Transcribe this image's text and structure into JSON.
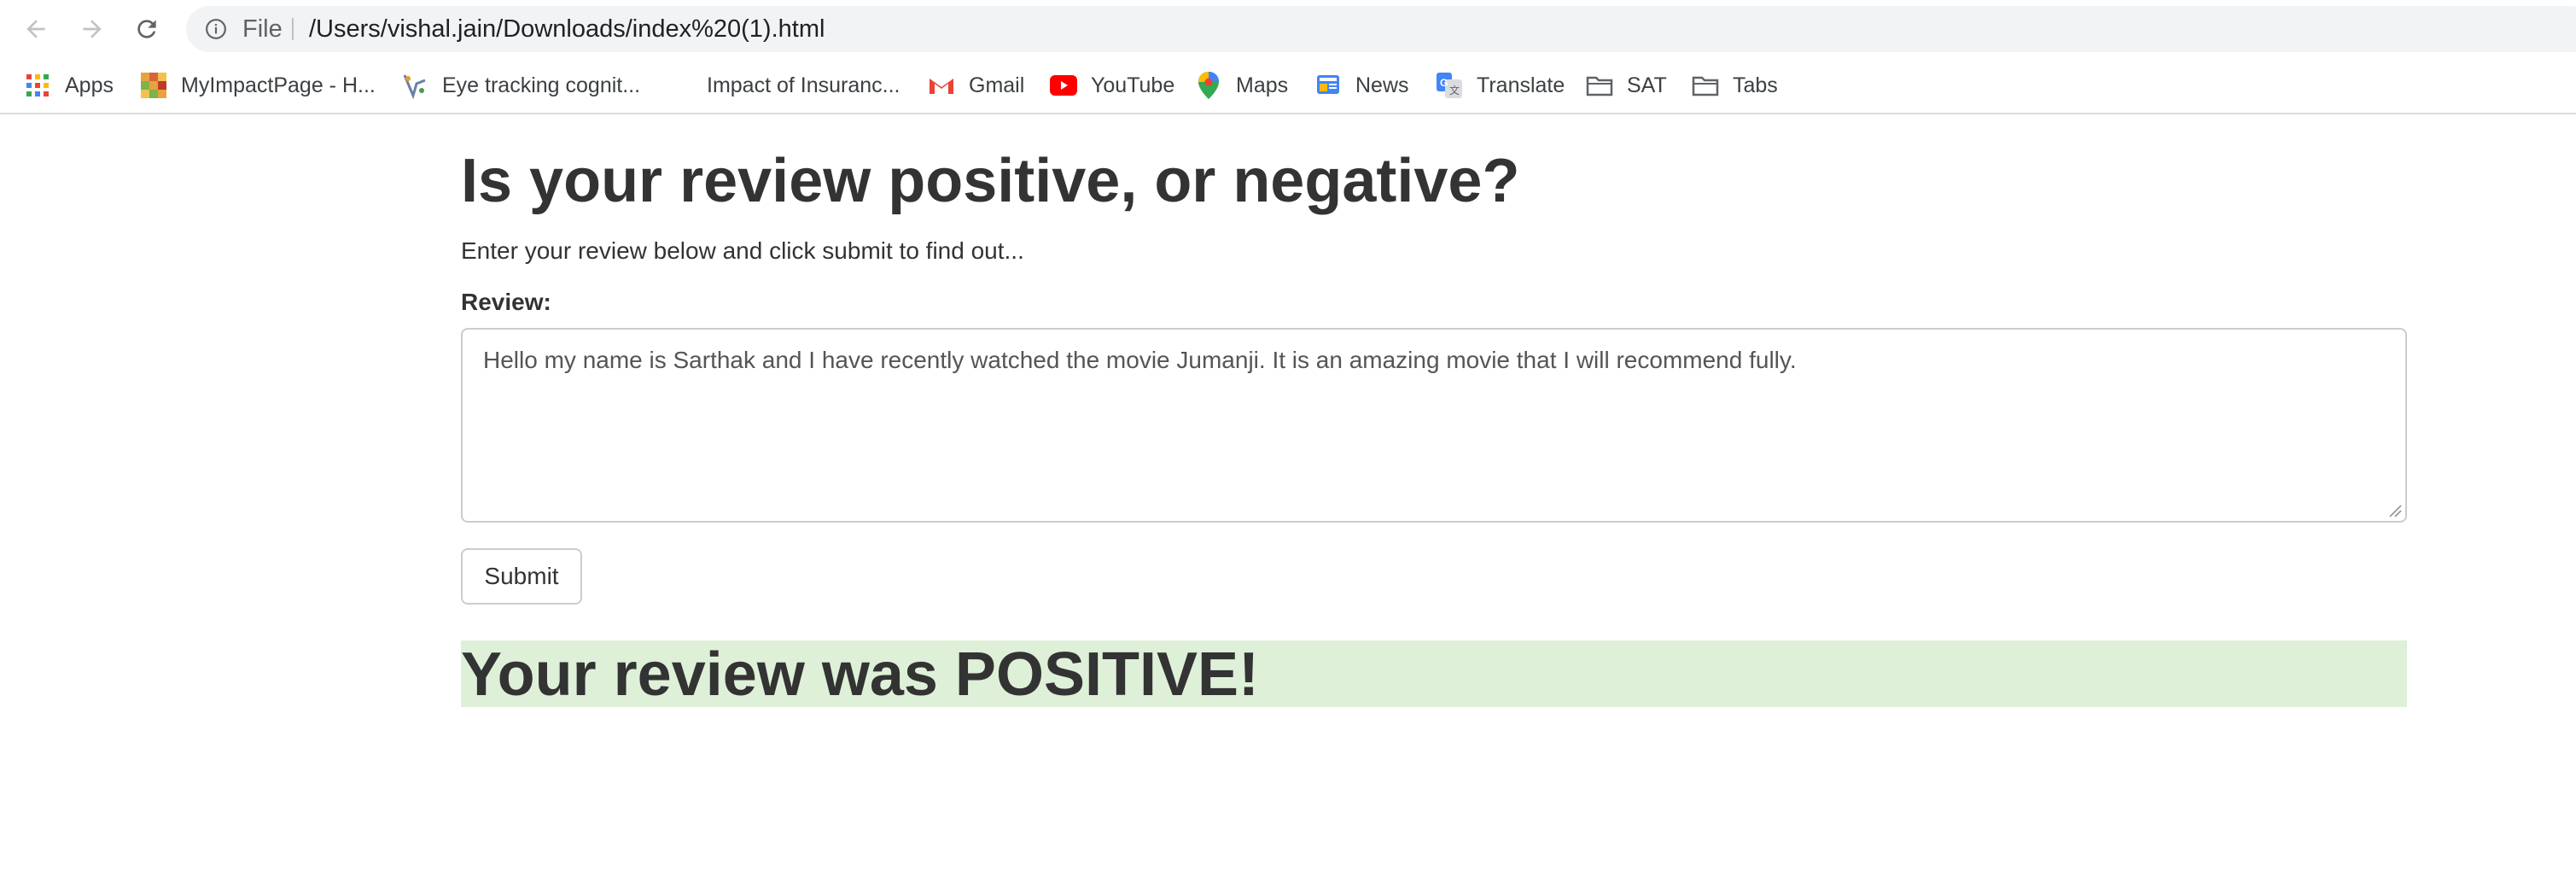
{
  "browser": {
    "scheme_label": "File",
    "url": "/Users/vishal.jain/Downloads/index%20(1).html",
    "nav_icons": [
      "back-arrow-icon",
      "forward-arrow-icon",
      "reload-icon",
      "info-icon"
    ]
  },
  "bookmarks": [
    {
      "label": "Apps",
      "icon": "apps-grid-icon"
    },
    {
      "label": "MyImpactPage - H...",
      "icon": "myimpactpage-icon"
    },
    {
      "label": "Eye tracking cognit...",
      "icon": "eye-tracking-icon"
    },
    {
      "label": "Impact of Insuranc...",
      "icon": ""
    },
    {
      "label": "Gmail",
      "icon": "gmail-icon"
    },
    {
      "label": "YouTube",
      "icon": "youtube-icon"
    },
    {
      "label": "Maps",
      "icon": "maps-pin-icon"
    },
    {
      "label": "News",
      "icon": "news-icon"
    },
    {
      "label": "Translate",
      "icon": "translate-icon"
    },
    {
      "label": "SAT",
      "icon": "folder-icon"
    },
    {
      "label": "Tabs",
      "icon": "folder-icon"
    }
  ],
  "page": {
    "title": "Is your review positive, or negative?",
    "subtitle": "Enter your review below and click submit to find out...",
    "review_label": "Review:",
    "review_value": "Hello my name is Sarthak and I have recently watched the movie Jumanji. It is an amazing movie that I will recommend fully.",
    "submit_label": "Submit",
    "result_text": "Your review was POSITIVE!"
  },
  "colors": {
    "result_background": "#dff0d8",
    "text": "#333333",
    "omnibox_background": "#f1f3f4"
  }
}
